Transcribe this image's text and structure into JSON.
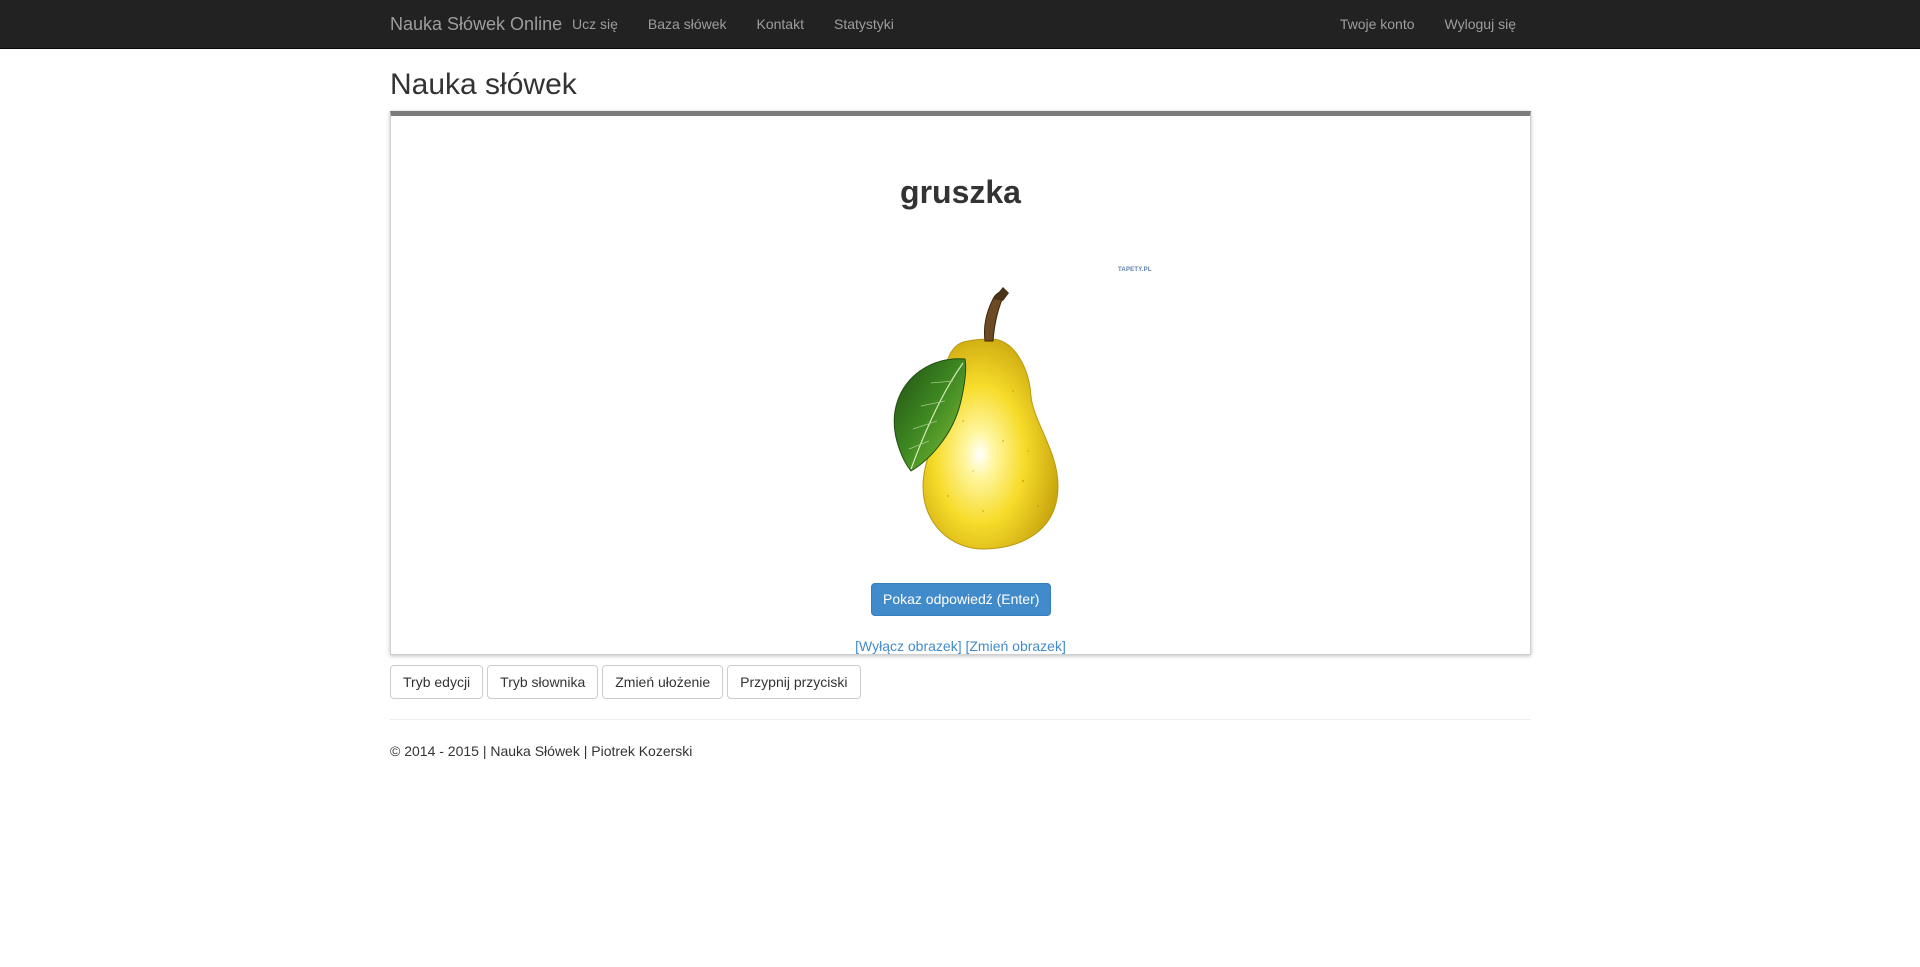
{
  "navbar": {
    "brand": "Nauka Słówek Online",
    "left_items": [
      "Ucz się",
      "Baza słówek",
      "Kontakt",
      "Statystyki"
    ],
    "right_items": [
      "Twoje konto",
      "Wyloguj się"
    ],
    "background": "#222222"
  },
  "page": {
    "title": "Nauka słówek"
  },
  "card": {
    "word": "gruszka",
    "image_icon": "pear-illustration",
    "watermark": "TAPETY.PL",
    "show_answer_button": "Pokaz odpowiedź (Enter)",
    "disable_image_link": "[Wyłącz obrazek]",
    "change_image_link": "[Zmień obrazek]",
    "accent_color": "#428bca"
  },
  "toolbar": {
    "buttons": [
      "Tryb edycji",
      "Tryb słownika",
      "Zmień ułożenie",
      "Przypnij przyciski"
    ]
  },
  "footer": {
    "text": "© 2014 - 2015 | Nauka Słówek | Piotrek Kozerski"
  }
}
